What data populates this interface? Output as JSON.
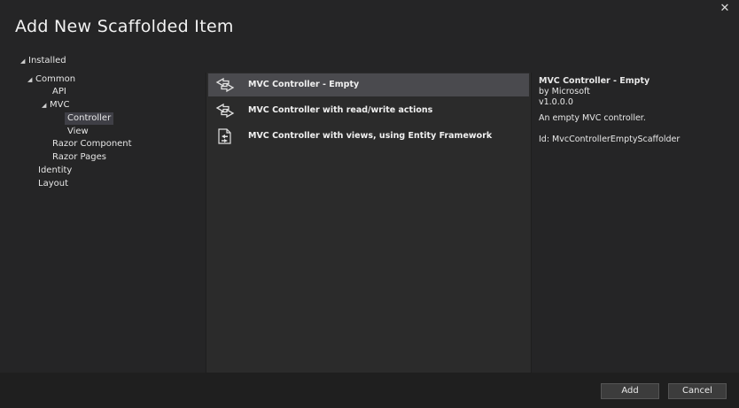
{
  "window": {
    "title": "Add New Scaffolded Item",
    "close_glyph": "✕"
  },
  "tree": {
    "installed": "Installed",
    "common": "Common",
    "api": "API",
    "mvc": "MVC",
    "controller": "Controller",
    "view": "View",
    "razor_component": "Razor Component",
    "razor_pages": "Razor Pages",
    "identity": "Identity",
    "layout": "Layout"
  },
  "list": {
    "items": [
      {
        "label": "MVC Controller - Empty",
        "icon": "controller-icon",
        "selected": true
      },
      {
        "label": "MVC Controller with read/write actions",
        "icon": "controller-icon",
        "selected": false
      },
      {
        "label": "MVC Controller with views, using Entity Framework",
        "icon": "controller-views-icon",
        "selected": false
      }
    ]
  },
  "details": {
    "title": "MVC Controller - Empty",
    "by": "by Microsoft",
    "version": "v1.0.0.0",
    "description": "An empty MVC controller.",
    "id": "Id: MvcControllerEmptyScaffolder"
  },
  "footer": {
    "add_label": "Add",
    "cancel_label": "Cancel"
  },
  "colors": {
    "background": "#252526",
    "list_bg": "#2b2b2b",
    "selection": "#4a4a4e"
  }
}
